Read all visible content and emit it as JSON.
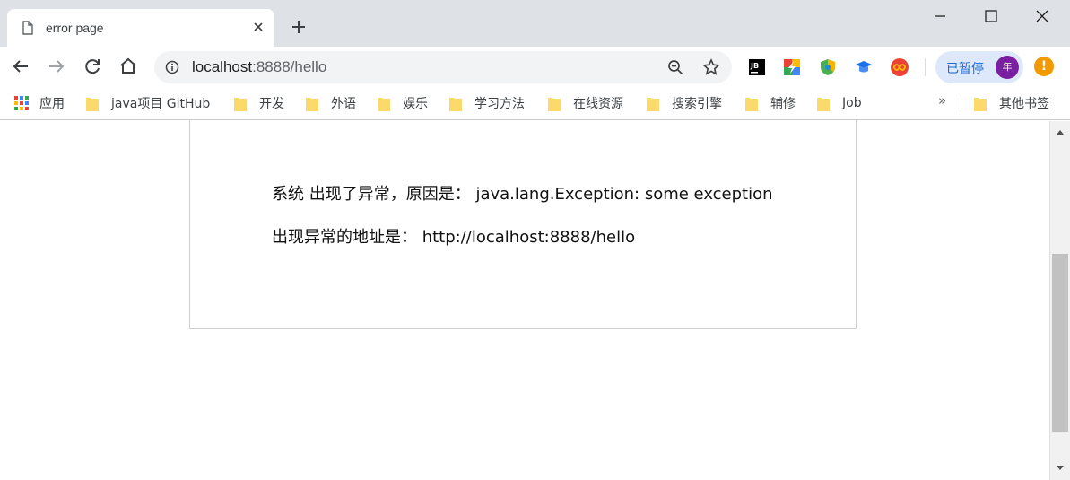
{
  "tab": {
    "title": "error page"
  },
  "address_bar": {
    "host": "localhost",
    "path": ":8888/hello"
  },
  "profile": {
    "label": "已暂停",
    "avatar_text": "年"
  },
  "extensions": [
    "jetbrains-icon",
    "colorful-icon",
    "shield-icon",
    "graduation-cap-icon",
    "infinity-icon"
  ],
  "bookmarks": {
    "apps_label": "应用",
    "items": [
      "java项目 GitHub",
      "开发",
      "外语",
      "娱乐",
      "学习方法",
      "在线资源",
      "搜索引擎",
      "辅修",
      "Job"
    ],
    "overflow": "»",
    "other": "其他书签"
  },
  "page": {
    "line1": "系统 出现了异常，原因是： java.lang.Exception: some exception",
    "line2": "出现异常的地址是： http://localhost:8888/hello"
  },
  "colors": {
    "titlebar": "#dee1e6",
    "omnibox": "#f1f3f4",
    "folder": "#fbd96a",
    "profile_bg": "#dde8fb",
    "avatar": "#7b1fa2",
    "alert": "#f29900"
  }
}
